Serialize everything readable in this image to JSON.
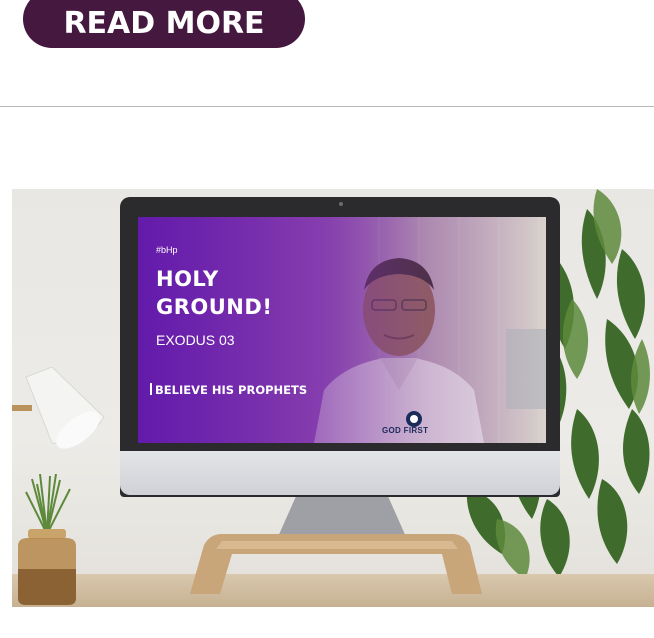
{
  "read_more": {
    "label": "READ MORE"
  },
  "video": {
    "hashtag": "#bHp",
    "title_line1": "HOLY",
    "title_line2": "GROUND!",
    "subtitle": "EXODUS 03",
    "tagline": "BELIEVE HIS PROPHETS",
    "logo_text": "GOD FIRST"
  },
  "colors": {
    "button_bg": "#45183f",
    "button_text": "#ffffff",
    "screen_purple": "#6f22b8",
    "divider": "#b8b8b8"
  },
  "icons": [
    "desk-lamp-icon",
    "plant-icon",
    "god-first-logo-icon"
  ]
}
